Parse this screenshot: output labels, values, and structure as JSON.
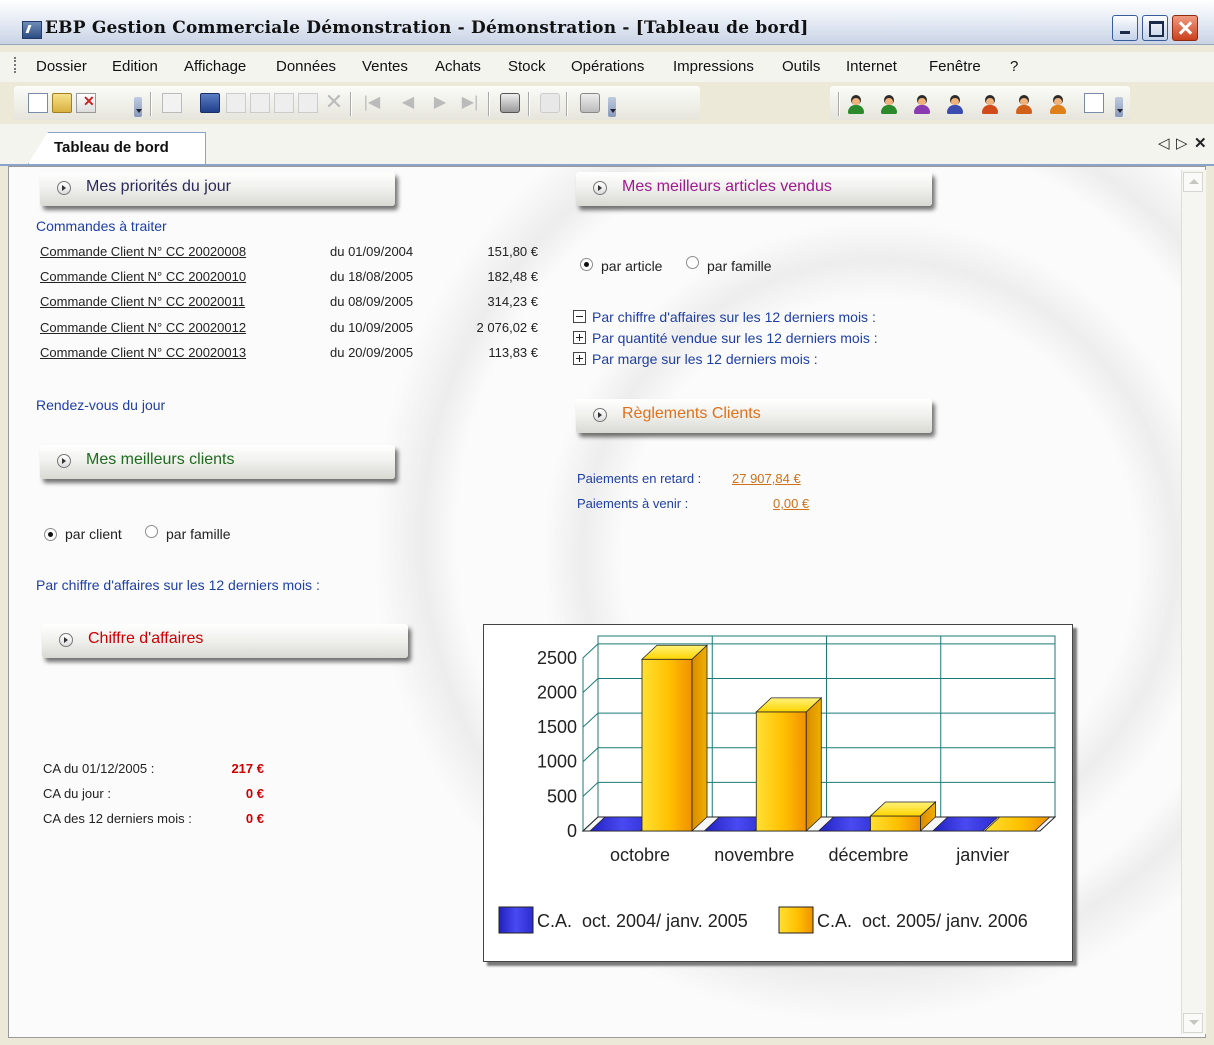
{
  "window": {
    "title": "EBP Gestion Commerciale Démonstration  - Démonstration - [Tableau de bord]"
  },
  "menu": [
    "Dossier",
    "Edition",
    "Affichage",
    "Données",
    "Ventes",
    "Achats",
    "Stock",
    "Opérations",
    "Impressions",
    "Outils",
    "Internet",
    "Fenêtre",
    "?"
  ],
  "tab": {
    "label": "Tableau de bord"
  },
  "priorites": {
    "title": "Mes priorités du jour",
    "commandes_label": "Commandes à traiter",
    "commandes": [
      {
        "name": "Commande Client N° CC 20020008",
        "date": "du 01/09/2004",
        "amount": "151,80 €"
      },
      {
        "name": "Commande Client N° CC 20020010",
        "date": "du 18/08/2005",
        "amount": "182,48 €"
      },
      {
        "name": "Commande Client N° CC 20020011",
        "date": "du 08/09/2005",
        "amount": "314,23 €"
      },
      {
        "name": "Commande Client N° CC 20020012",
        "date": "du 10/09/2005",
        "amount": "2 076,02 €"
      },
      {
        "name": "Commande Client N° CC 20020013",
        "date": "du 20/09/2005",
        "amount": "113,83 €"
      }
    ],
    "rdv_label": "Rendez-vous du jour"
  },
  "clients": {
    "title": "Mes meilleurs clients",
    "option_client": "par client",
    "option_famille": "par famille",
    "selected": "par client",
    "ca_label": "Par chiffre d'affaires sur les 12 derniers mois :"
  },
  "chiffre": {
    "title": "Chiffre d'affaires",
    "rows": [
      {
        "label": "CA du 01/12/2005 :",
        "value": "217 €"
      },
      {
        "label": "CA du jour :",
        "value": "0 €"
      },
      {
        "label": "CA des 12 derniers mois :",
        "value": "0 €"
      }
    ]
  },
  "articles": {
    "title": "Mes meilleurs articles vendus",
    "option_article": "par article",
    "option_famille": "par famille",
    "selected": "par article",
    "links": [
      {
        "label": "Par chiffre d'affaires sur les 12 derniers mois :",
        "icon": "minus-box-icon"
      },
      {
        "label": "Par quantité vendue sur les 12 derniers mois :",
        "icon": "plus-box-icon"
      },
      {
        "label": "Par marge sur les 12 derniers mois :",
        "icon": "plus-box-icon"
      }
    ]
  },
  "reglements": {
    "title": "Règlements Clients",
    "retard_label": "Paiements en retard :",
    "retard_value": "27 907,84 €",
    "venir_label": "Paiements à venir :",
    "venir_value": "0,00 €"
  },
  "colors": {
    "priorites": "#2a2a5a",
    "clients": "#1f6b1f",
    "chiffre": "#cc0000",
    "articles": "#a01890",
    "reglements": "#e0701a",
    "amount_red": "#cc0000",
    "link_blue": "#1e3fa6",
    "series_blue": "#3b3bdc",
    "series_yellow": "#ffc400"
  },
  "chart_data": {
    "type": "bar",
    "categories": [
      "octobre",
      "novembre",
      "décembre",
      "janvier"
    ],
    "series": [
      {
        "name": "C.A.  oct. 2004/ janv. 2005",
        "values": [
          0,
          0,
          0,
          0
        ]
      },
      {
        "name": "C.A.  oct. 2005/ janv. 2006",
        "values": [
          2480,
          1720,
          217,
          0
        ]
      }
    ],
    "yticks": [
      0,
      500,
      1000,
      1500,
      2000,
      2500
    ],
    "ylim": [
      0,
      2700
    ],
    "grid": true,
    "legend": "bottom"
  }
}
